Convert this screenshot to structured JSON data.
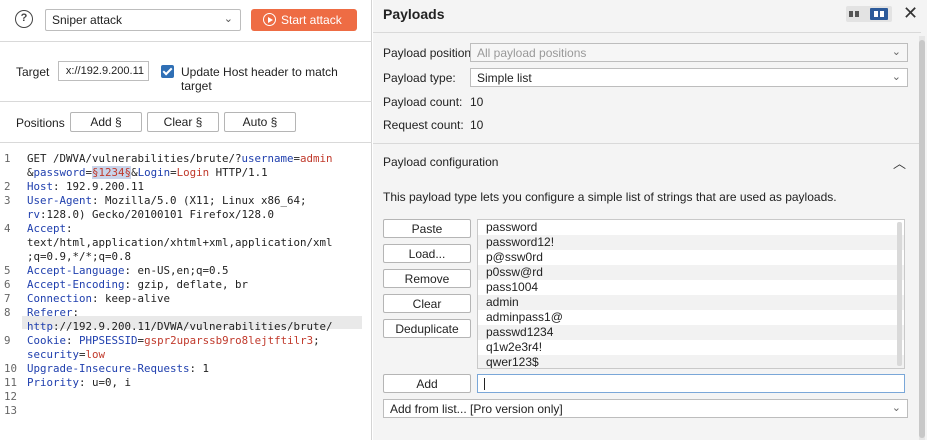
{
  "toolbar": {
    "help_icon": "question-icon",
    "attack_type": "Sniper attack",
    "start_label": "Start attack",
    "start_color": "#ee6c44"
  },
  "target": {
    "label": "Target",
    "value": "x://192.9.200.11",
    "update_host_label": "Update Host header to match target",
    "update_host_checked": true
  },
  "positions": {
    "label": "Positions",
    "add": "Add §",
    "clear": "Clear §",
    "auto": "Auto §"
  },
  "editor": {
    "line_numbers": [
      "1",
      "2",
      "3",
      "4",
      "5",
      "6",
      "7",
      "8",
      "9",
      "10",
      "11",
      "12",
      "13"
    ],
    "lines": [
      "GET /DWVA/vulnerabilities/brute/?username=admin",
      "&password=§1234§&Login=Login HTTP/1.1",
      "Host: 192.9.200.11",
      "User-Agent: Mozilla/5.0 (X11; Linux x86_64;",
      "rv:128.0) Gecko/20100101 Firefox/128.0",
      "Accept:",
      "text/html,application/xhtml+xml,application/xml",
      ";q=0.9,*/*;q=0.8",
      "Accept-Language: en-US,en;q=0.5",
      "Accept-Encoding: gzip, deflate, br",
      "Connection: keep-alive",
      "Referer:",
      "http://192.9.200.11/DVWA/vulnerabilities/brute/",
      "Cookie: PHPSESSID=gspr2uparssb9ro8lejtftilr3;",
      "security=low",
      "Upgrade-Insecure-Requests: 1",
      "Priority: u=0, i"
    ]
  },
  "payloads": {
    "title": "Payloads",
    "position_label": "Payload position:",
    "position_value": "All payload positions",
    "type_label": "Payload type:",
    "type_value": "Simple list",
    "count_label": "Payload count:",
    "count_value": "10",
    "request_label": "Request count:",
    "request_value": "10",
    "config_title": "Payload configuration",
    "description": "This payload type lets you configure a simple list of strings that are used as payloads.",
    "buttons": {
      "paste": "Paste",
      "load": "Load...",
      "remove": "Remove",
      "clear": "Clear",
      "deduplicate": "Deduplicate",
      "add": "Add"
    },
    "items": [
      "password",
      "password12!",
      "p@ssw0rd",
      "p0ssw@rd",
      "pass1004",
      "admin",
      "adminpass1@",
      "passwd1234",
      "q1w2e3r4!",
      "qwer123$"
    ],
    "add_from_list": "Add from list... [Pro version only]"
  }
}
